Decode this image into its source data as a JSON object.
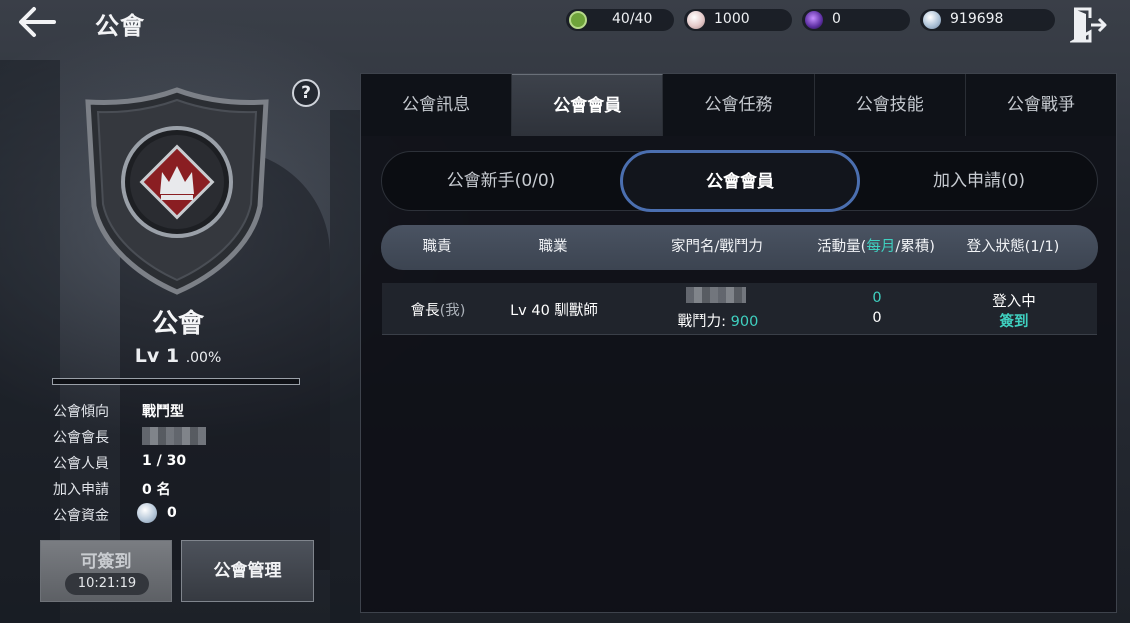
{
  "header": {
    "title": "公會",
    "resources": [
      {
        "icon": "stamina-icon",
        "value": "40/40"
      },
      {
        "icon": "pearl-icon",
        "value": "1000"
      },
      {
        "icon": "purple-gem-icon",
        "value": "0"
      },
      {
        "icon": "silver-coin-icon",
        "value": "919698"
      }
    ]
  },
  "guild": {
    "name": "公會",
    "level": "Lv 1",
    "level_pct": ".00%",
    "exp_fraction": 0.0,
    "info": [
      {
        "label": "公會傾向",
        "value": "戰鬥型"
      },
      {
        "label": "公會會長",
        "value": ""
      },
      {
        "label": "公會人員",
        "value": "1 / 30"
      },
      {
        "label": "加入申請",
        "value": "0 名"
      },
      {
        "label": "公會資金",
        "value": "0"
      }
    ],
    "checkin_label": "可簽到",
    "checkin_timer": "10:21:19",
    "manage_label": "公會管理"
  },
  "tabs": [
    "公會訊息",
    "公會會員",
    "公會任務",
    "公會技能",
    "公會戰爭"
  ],
  "active_tab": "公會會員",
  "subtabs": [
    "公會新手(0/0)",
    "公會會員",
    "加入申請(0)"
  ],
  "table": {
    "headers": {
      "role": "職責",
      "class": "職業",
      "family": "家門名/戰鬥力",
      "activity_prefix": "活動量(",
      "activity_monthly": "每月",
      "activity_suffix": "/累積)",
      "login": "登入狀態(1/1)"
    },
    "rows": [
      {
        "role": "會長",
        "role_me": "(我)",
        "class": "Lv 40 馴獸師",
        "power_label": "戰鬥力: ",
        "power_value": "900",
        "activity_monthly": "0",
        "activity_total": "0",
        "login_status": "登入中",
        "checkin_status": "簽到"
      }
    ]
  },
  "colors": {
    "accent_teal": "#3fd0c0",
    "active_subtab_border": "#4b6fb0"
  }
}
